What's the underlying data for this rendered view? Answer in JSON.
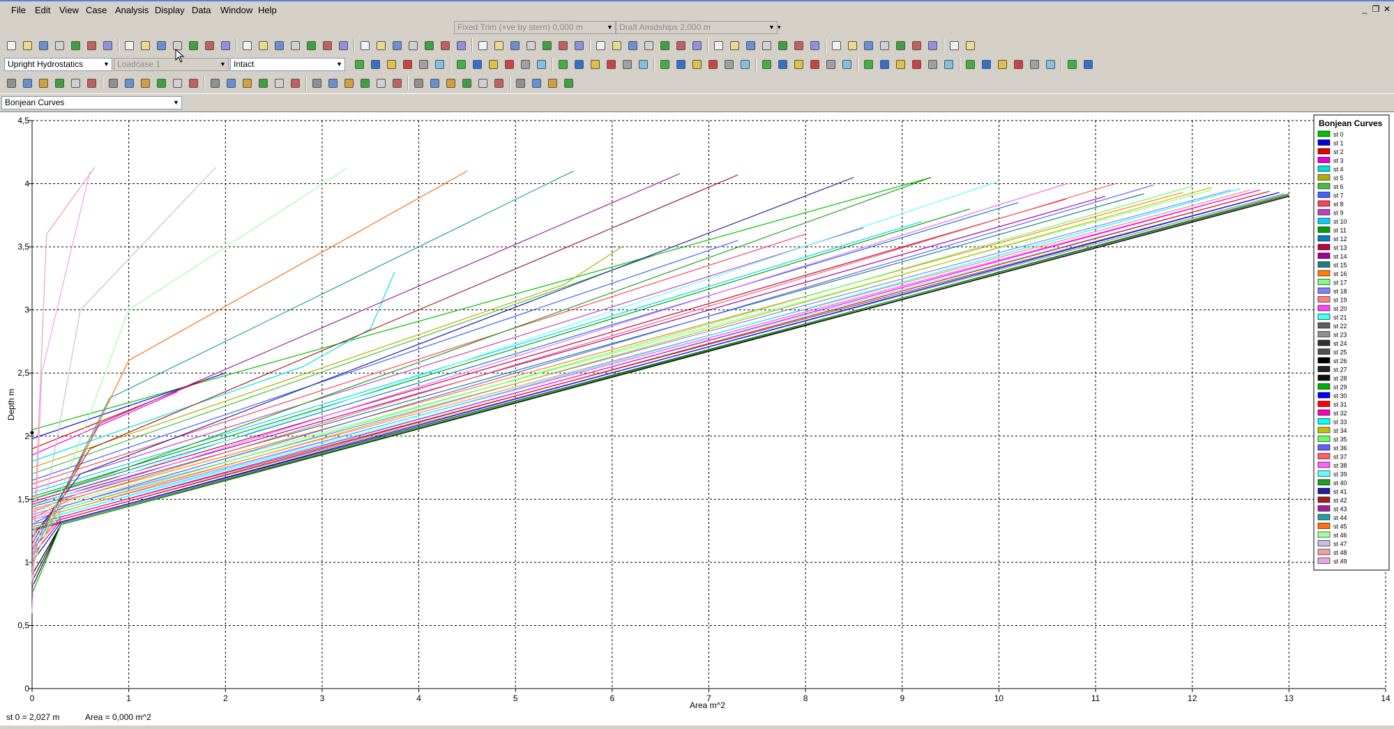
{
  "menu": [
    "File",
    "Edit",
    "View",
    "Case",
    "Analysis",
    "Display",
    "Data",
    "Window",
    "Help"
  ],
  "trim": {
    "mode_value": "Fixed Trim (+ve by stern) 0,000 m",
    "draft_value": "Draft Amidships 2,000 m"
  },
  "analysis": {
    "type_value": "Upright Hydrostatics",
    "loadcase_value": "Loadcase 1",
    "damage_value": "Intact"
  },
  "view": {
    "selector_value": "Bonjean Curves"
  },
  "status": {
    "station_readout": "st 0 =  2,027 m",
    "area_readout": "Area =  0,000 m^2"
  },
  "chart_data": {
    "type": "line",
    "title": "",
    "xlabel": "Area  m^2",
    "ylabel": "Depth  m",
    "xlim": [
      0,
      14
    ],
    "ylim": [
      0,
      4.5
    ],
    "xticks": [
      "0",
      "1",
      "2",
      "3",
      "4",
      "5",
      "6",
      "7",
      "8",
      "9",
      "10",
      "11",
      "12",
      "13",
      "14"
    ],
    "yticks": [
      "0",
      "0,5",
      "1",
      "1,5",
      "2",
      "2,5",
      "3",
      "3,5",
      "4",
      "4,5"
    ],
    "grid": true,
    "legend_title": "Bonjean Curves",
    "legend_position": "right",
    "series": [
      {
        "name": "st 0",
        "color": "#00c000",
        "points": [
          [
            0,
            2.05
          ],
          [
            9.3,
            4.05
          ]
        ]
      },
      {
        "name": "st 1",
        "color": "#0000e0",
        "points": [
          [
            0,
            1.98
          ],
          [
            2.0,
            2.5
          ]
        ]
      },
      {
        "name": "st 2",
        "color": "#e00000",
        "points": [
          [
            0,
            1.9
          ],
          [
            1.8,
            2.45
          ]
        ]
      },
      {
        "name": "st 3",
        "color": "#e000e0",
        "points": [
          [
            0,
            1.85
          ],
          [
            1.5,
            2.35
          ]
        ]
      },
      {
        "name": "st 4",
        "color": "#00e0e0",
        "points": [
          [
            0,
            1.8
          ],
          [
            2.8,
            2.55
          ],
          [
            3.5,
            2.85
          ],
          [
            3.75,
            3.3
          ]
        ]
      },
      {
        "name": "st 5",
        "color": "#b0b000",
        "points": [
          [
            0,
            1.75
          ],
          [
            5.5,
            3.2
          ],
          [
            6.1,
            3.5
          ]
        ]
      },
      {
        "name": "st 6",
        "color": "#40c040",
        "points": [
          [
            0,
            1.7
          ],
          [
            6.5,
            3.45
          ]
        ]
      },
      {
        "name": "st 7",
        "color": "#4060ff",
        "points": [
          [
            0,
            1.65
          ],
          [
            7.3,
            3.55
          ]
        ]
      },
      {
        "name": "st 8",
        "color": "#ff4060",
        "points": [
          [
            0,
            1.62
          ],
          [
            8.0,
            3.6
          ]
        ]
      },
      {
        "name": "st 9",
        "color": "#c040c0",
        "points": [
          [
            0,
            1.58
          ],
          [
            8.6,
            3.65
          ]
        ]
      },
      {
        "name": "st 10",
        "color": "#00d0ff",
        "points": [
          [
            0,
            1.55
          ],
          [
            9.2,
            3.7
          ]
        ]
      },
      {
        "name": "st 11",
        "color": "#00a000",
        "points": [
          [
            0,
            1.52
          ],
          [
            9.7,
            3.8
          ]
        ]
      },
      {
        "name": "st 12",
        "color": "#0080c0",
        "points": [
          [
            0,
            1.5
          ],
          [
            10.2,
            3.85
          ]
        ]
      },
      {
        "name": "st 13",
        "color": "#c00040",
        "points": [
          [
            0,
            1.48
          ],
          [
            10.7,
            3.88
          ]
        ]
      },
      {
        "name": "st 14",
        "color": "#a000a0",
        "points": [
          [
            0,
            1.46
          ],
          [
            11.1,
            3.9
          ]
        ]
      },
      {
        "name": "st 15",
        "color": "#208080",
        "points": [
          [
            0,
            1.44
          ],
          [
            11.5,
            3.92
          ]
        ]
      },
      {
        "name": "st 16",
        "color": "#ff8000",
        "points": [
          [
            0,
            1.42
          ],
          [
            11.9,
            3.93
          ]
        ]
      },
      {
        "name": "st 17",
        "color": "#80ff80",
        "points": [
          [
            0,
            1.4
          ],
          [
            12.2,
            3.95
          ]
        ]
      },
      {
        "name": "st 18",
        "color": "#8080ff",
        "points": [
          [
            0,
            1.38
          ],
          [
            12.4,
            3.95
          ]
        ]
      },
      {
        "name": "st 19",
        "color": "#ff8080",
        "points": [
          [
            0,
            1.36
          ],
          [
            12.6,
            3.95
          ]
        ]
      },
      {
        "name": "st 20",
        "color": "#ff40ff",
        "points": [
          [
            0,
            1.34
          ],
          [
            12.7,
            3.95
          ]
        ]
      },
      {
        "name": "st 21",
        "color": "#40ffff",
        "points": [
          [
            0,
            1.32
          ],
          [
            12.8,
            3.94
          ]
        ]
      },
      {
        "name": "st 22",
        "color": "#606060",
        "points": [
          [
            0,
            1.3
          ],
          [
            12.9,
            3.93
          ]
        ]
      },
      {
        "name": "st 23",
        "color": "#909090",
        "points": [
          [
            0,
            1.28
          ],
          [
            12.95,
            3.92
          ]
        ]
      },
      {
        "name": "st 24",
        "color": "#303030",
        "points": [
          [
            0,
            1.26
          ],
          [
            13.0,
            3.91
          ]
        ]
      },
      {
        "name": "st 25",
        "color": "#505050",
        "points": [
          [
            0,
            1.25
          ],
          [
            13.0,
            3.9
          ]
        ]
      },
      {
        "name": "st 26",
        "color": "#000000",
        "points": [
          [
            0,
            0.9
          ],
          [
            0.3,
            1.3
          ],
          [
            13.0,
            3.9
          ]
        ]
      },
      {
        "name": "st 27",
        "color": "#202020",
        "points": [
          [
            0,
            0.85
          ],
          [
            0.3,
            1.3
          ],
          [
            13.0,
            3.9
          ]
        ]
      },
      {
        "name": "st 28",
        "color": "#101010",
        "points": [
          [
            0,
            0.8
          ],
          [
            0.3,
            1.3
          ],
          [
            13.0,
            3.9
          ]
        ]
      },
      {
        "name": "st 29",
        "color": "#00b000",
        "points": [
          [
            0,
            0.75
          ],
          [
            0.3,
            1.3
          ],
          [
            13.0,
            3.92
          ]
        ]
      },
      {
        "name": "st 30",
        "color": "#0000ff",
        "points": [
          [
            0,
            1.0
          ],
          [
            0.3,
            1.32
          ],
          [
            12.9,
            3.93
          ]
        ]
      },
      {
        "name": "st 31",
        "color": "#ff0000",
        "points": [
          [
            0,
            1.05
          ],
          [
            0.3,
            1.34
          ],
          [
            12.8,
            3.94
          ]
        ]
      },
      {
        "name": "st 32",
        "color": "#ff00c0",
        "points": [
          [
            0,
            1.1
          ],
          [
            0.3,
            1.36
          ],
          [
            12.7,
            3.95
          ]
        ]
      },
      {
        "name": "st 33",
        "color": "#00ffff",
        "points": [
          [
            0,
            1.15
          ],
          [
            0.3,
            1.38
          ],
          [
            12.5,
            3.96
          ]
        ]
      },
      {
        "name": "st 34",
        "color": "#c0c000",
        "points": [
          [
            0,
            1.2
          ],
          [
            0.3,
            1.4
          ],
          [
            12.2,
            3.97
          ]
        ]
      },
      {
        "name": "st 35",
        "color": "#60ff60",
        "points": [
          [
            0,
            1.25
          ],
          [
            0.3,
            1.42
          ],
          [
            12.0,
            3.98
          ]
        ]
      },
      {
        "name": "st 36",
        "color": "#6060ff",
        "points": [
          [
            0,
            1.3
          ],
          [
            0.35,
            1.45
          ],
          [
            11.6,
            3.99
          ]
        ]
      },
      {
        "name": "st 37",
        "color": "#ff6060",
        "points": [
          [
            0,
            1.35
          ],
          [
            0.4,
            1.5
          ],
          [
            11.2,
            4.0
          ]
        ]
      },
      {
        "name": "st 38",
        "color": "#ff60ff",
        "points": [
          [
            0,
            1.4
          ],
          [
            0.5,
            1.55
          ],
          [
            10.7,
            4.0
          ]
        ]
      },
      {
        "name": "st 39",
        "color": "#60ffff",
        "points": [
          [
            0,
            1.45
          ],
          [
            0.6,
            1.6
          ],
          [
            10.0,
            4.02
          ]
        ]
      },
      {
        "name": "st 40",
        "color": "#20a020",
        "points": [
          [
            0,
            1.5
          ],
          [
            0.8,
            1.7
          ],
          [
            9.3,
            4.05
          ]
        ]
      },
      {
        "name": "st 41",
        "color": "#2020a0",
        "points": [
          [
            0,
            1.2
          ],
          [
            0.5,
            1.7
          ],
          [
            8.5,
            4.05
          ]
        ]
      },
      {
        "name": "st 42",
        "color": "#a02020",
        "points": [
          [
            0,
            1.15
          ],
          [
            0.6,
            1.9
          ],
          [
            7.3,
            4.07
          ]
        ]
      },
      {
        "name": "st 43",
        "color": "#a020a0",
        "points": [
          [
            0,
            1.1
          ],
          [
            0.7,
            2.1
          ],
          [
            6.7,
            4.08
          ]
        ]
      },
      {
        "name": "st 44",
        "color": "#20a0a0",
        "points": [
          [
            0,
            1.05
          ],
          [
            0.8,
            2.3
          ],
          [
            5.6,
            4.1
          ]
        ]
      },
      {
        "name": "st 45",
        "color": "#ff7010",
        "points": [
          [
            0,
            1.0
          ],
          [
            1.0,
            2.6
          ],
          [
            4.5,
            4.1
          ]
        ]
      },
      {
        "name": "st 46",
        "color": "#a0ffa0",
        "points": [
          [
            0,
            0.95
          ],
          [
            1.0,
            3.0
          ],
          [
            3.25,
            4.12
          ]
        ]
      },
      {
        "name": "st 47",
        "color": "#c0c0e0",
        "points": [
          [
            0,
            0.9
          ],
          [
            0.5,
            3.0
          ],
          [
            1.9,
            4.13
          ]
        ]
      },
      {
        "name": "st 48",
        "color": "#f0a0a0",
        "points": [
          [
            0,
            0.85
          ],
          [
            0.15,
            3.6
          ],
          [
            0.65,
            4.13
          ]
        ]
      },
      {
        "name": "st 49",
        "color": "#f0a0f0",
        "points": [
          [
            0,
            0.6
          ],
          [
            0.1,
            2.5
          ],
          [
            0.6,
            4.1
          ]
        ]
      }
    ]
  }
}
